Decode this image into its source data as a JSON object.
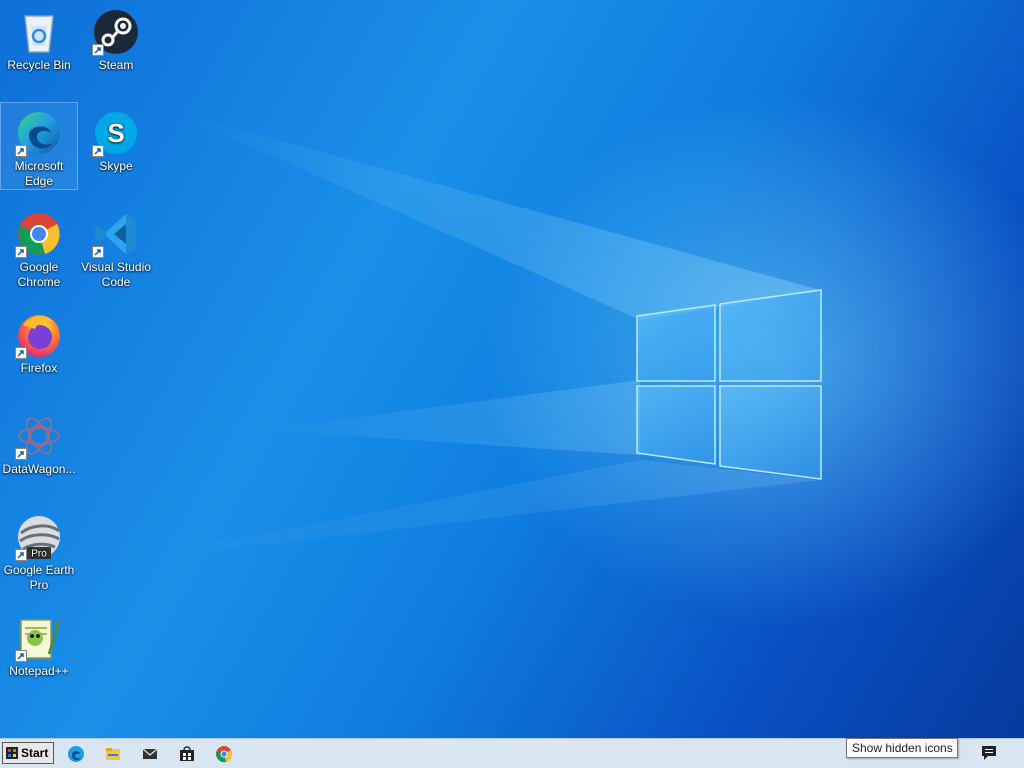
{
  "desktop": {
    "icons": [
      {
        "label": "Recycle Bin",
        "icon": "recycle-bin-icon"
      },
      {
        "label": "Steam",
        "icon": "steam-icon"
      },
      {
        "label": "Microsoft Edge",
        "icon": "edge-icon"
      },
      {
        "label": "Skype",
        "icon": "skype-icon"
      },
      {
        "label": "Google Chrome",
        "icon": "chrome-icon"
      },
      {
        "label": "Visual Studio Code",
        "icon": "vscode-icon"
      },
      {
        "label": "Firefox",
        "icon": "firefox-icon"
      },
      {
        "label": "DataWagon...",
        "icon": "datawagon-icon"
      },
      {
        "label": "Google Earth Pro",
        "icon": "google-earth-pro-icon",
        "badge": "Pro"
      },
      {
        "label": "Notepad++",
        "icon": "notepadpp-icon"
      }
    ]
  },
  "taskbar": {
    "start_label": "Start",
    "pinned": [
      "edge-icon",
      "file-explorer-icon",
      "mail-icon",
      "store-icon",
      "chrome-icon"
    ],
    "tooltip": "Show hidden icons",
    "notification_icon": "action-center-icon"
  },
  "colors": {
    "wallpaper": "#0e7ee0",
    "taskbar": "#d9e6f2"
  }
}
